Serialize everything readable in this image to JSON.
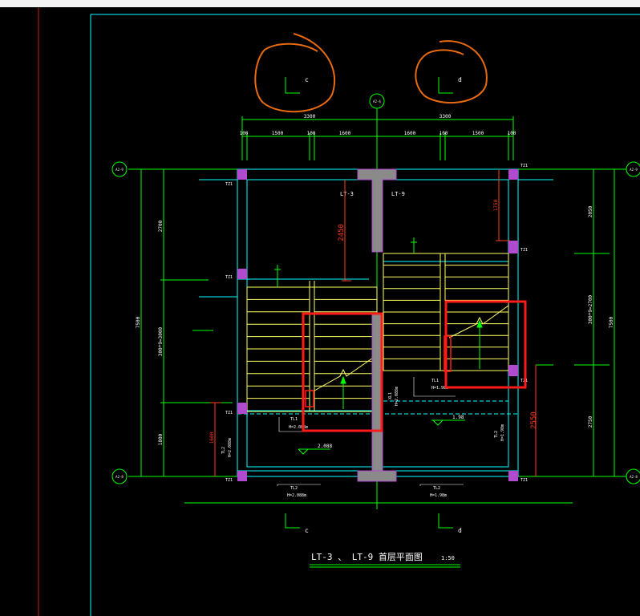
{
  "title": {
    "text": "LT-3 、 LT-9 首层平面图",
    "scale": "1:50"
  },
  "axes": {
    "top_left": "c",
    "top_right": "d",
    "bottom_left": "c",
    "bottom_right": "d",
    "center_top": "A2-4",
    "left_top": "A2-9",
    "left_bottom": "A2-8",
    "right_top": "A2-9",
    "right_bottom": "A2-8"
  },
  "stair_labels": {
    "left": "LT-3",
    "right": "LT-9"
  },
  "top_dims": {
    "total_left": "3300",
    "total_right": "3300",
    "seg1": "100",
    "seg2": "1500",
    "seg3": "100",
    "seg4": "1600",
    "seg5": "1600",
    "seg6": "100",
    "seg7": "1500",
    "seg8": "100"
  },
  "left_dims": {
    "total": "7500",
    "upper": "2700",
    "middle": "300*9=3000",
    "lower": "1800"
  },
  "right_dims": {
    "total": "7500",
    "upper": "2050",
    "middle": "300*9=2700",
    "lower": "2750"
  },
  "red_dims": {
    "d2450": "2450",
    "d1750": "1750",
    "d1600": "1600",
    "d2550": "2550"
  },
  "columns": {
    "tz1": "TZ1"
  },
  "beams": {
    "tl1_left": "TL1",
    "tl1_left_h": "H=2.088m",
    "tl1_right": "TL1",
    "tl1_right_h": "H=1.98m",
    "tl2_left": "TL2",
    "tl2_left_h": "H=2.088m",
    "tl2_right": "TL2",
    "tl2_right_h": "H=1.98m",
    "tl2_bot_left": "TL2",
    "tl2_bot_left_h": "H=2.088m",
    "tl2_bot_right": "TL2",
    "tl2_bot_right_h": "H=1.98m",
    "xl1": "XL1",
    "xl1_h": "H=2.088m"
  },
  "levels": {
    "left": "2.088",
    "right": "1.98"
  },
  "colors": {
    "background": "#000000",
    "frame": "#00ffff",
    "green": "#00ff00",
    "yellow": "#ffff66",
    "magenta": "#b04bd0",
    "red_dim": "#ff3b1f",
    "markup_red": "#ff1a1a",
    "markup_orange": "#e86a10",
    "gray_fill": "#8a8a8a"
  }
}
